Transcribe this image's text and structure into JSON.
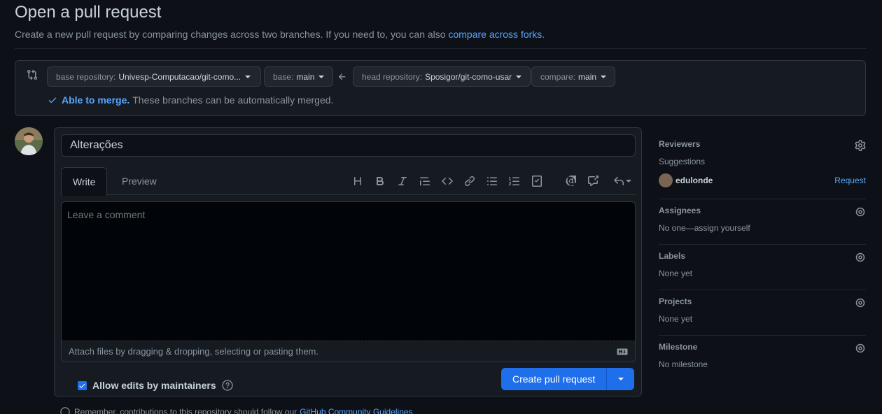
{
  "header": {
    "title": "Open a pull request",
    "subtitle": "Create a new pull request by comparing changes across two branches. If you need to, you can also",
    "subtitle_link": "compare across forks",
    "subtitle_end": "."
  },
  "compare": {
    "base_repo_label": "base repository:",
    "base_repo_value": "Univesp-Computacao/git-como...",
    "base_label": "base:",
    "base_value": "main",
    "head_repo_label": "head repository:",
    "head_repo_value": "Sposigor/git-como-usar",
    "compare_label": "compare:",
    "compare_value": "main",
    "merge_ok": "Able to merge.",
    "merge_text": "These branches can be automatically merged."
  },
  "form": {
    "title_value": "Alterações",
    "tabs": [
      {
        "label": "Write"
      },
      {
        "label": "Preview"
      }
    ],
    "comment_placeholder": "Leave a comment",
    "attach_text": "Attach files by dragging & dropping, selecting or pasting them.",
    "allow_edits_label": "Allow edits by maintainers",
    "create_button": "Create pull request",
    "footer_note": "Remember, contributions to this repository should follow our",
    "footer_link": "GitHub Community Guidelines"
  },
  "toolbar": {
    "icons": [
      "heading-icon",
      "bold-icon",
      "italic-icon",
      "quote-icon",
      "code-icon",
      "link-icon",
      "unordered-list-icon",
      "ordered-list-icon",
      "task-list-icon",
      "mention-icon",
      "cross-reference-icon",
      "reply-icon"
    ]
  },
  "sidebar": {
    "reviewers": {
      "heading": "Reviewers",
      "suggestions": "Suggestions",
      "user": "edulonde",
      "request": "Request"
    },
    "assignees": {
      "heading": "Assignees",
      "value": "No one—assign yourself"
    },
    "labels": {
      "heading": "Labels",
      "value": "None yet"
    },
    "projects": {
      "heading": "Projects",
      "value": "None yet"
    },
    "milestone": {
      "heading": "Milestone",
      "value": "No milestone"
    }
  },
  "colors": {
    "background": "#0d1117",
    "accent": "#1f6feb",
    "link": "#58a6ff",
    "border": "#30363d"
  }
}
